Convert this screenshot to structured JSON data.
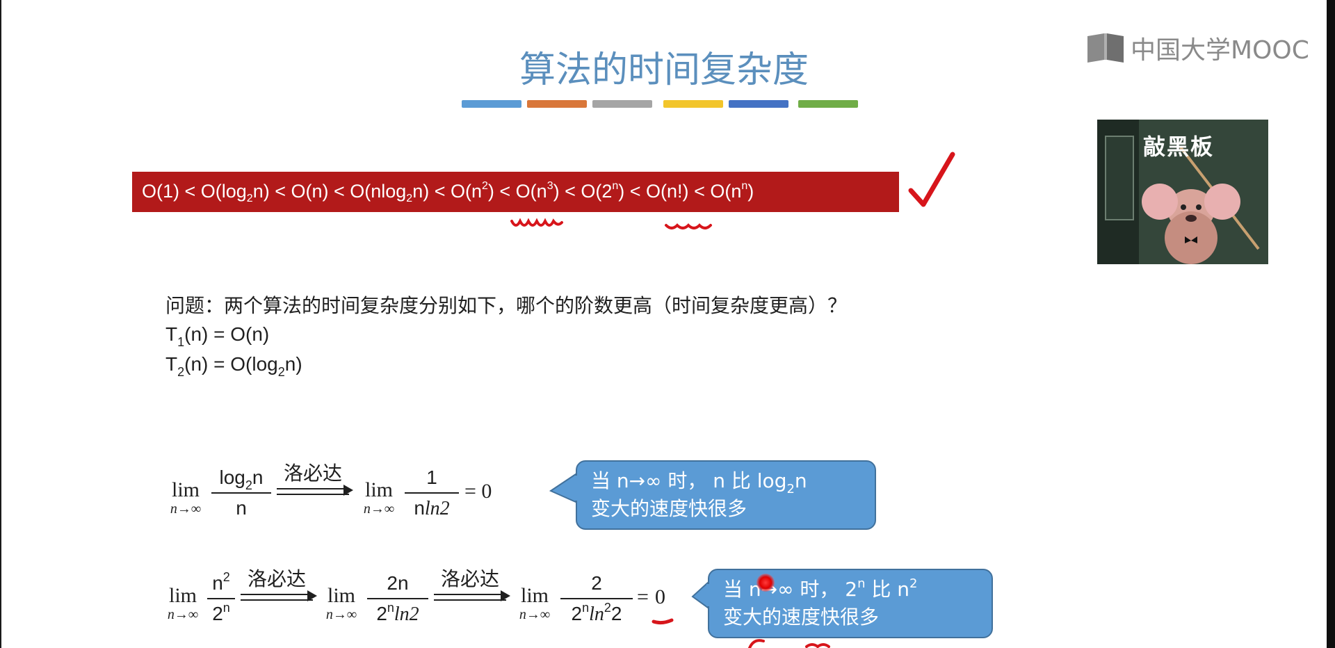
{
  "slide": {
    "title": "算法的时间复杂度",
    "logo_text": "中国大学MOOC",
    "promo_text": "敲黑板",
    "accent_colors": [
      "#5b9bd5",
      "#d9773a",
      "#a5a5a5",
      "#f2c52b",
      "#4472c4",
      "#70ad47"
    ],
    "banner": {
      "background": "#b21a1a",
      "terms": [
        "O(1)",
        "O(log2n)",
        "O(n)",
        "O(nlog2n)",
        "O(n2)",
        "O(n3)",
        "O(2n)",
        "O(n!)",
        "O(nn)"
      ]
    },
    "question": "问题：两个算法的时间复杂度分别如下，哪个的阶数更高（时间复杂度更高）？",
    "t1": {
      "lhs": "T",
      "sub": "1",
      "rest": "(n) = O(n)"
    },
    "t2": {
      "lhs": "T",
      "sub": "2",
      "rest_a": "(n) = O(log",
      "rest_sub": "2",
      "rest_b": "n)"
    },
    "formula1": {
      "lim": "lim",
      "lim_under": "n→∞",
      "num_a": "log",
      "num_sub": "2",
      "num_b": "n",
      "den": "n",
      "arrow_label": "洛必达",
      "num2": "1",
      "den2_a": "n",
      "den2_b": "ln2",
      "result": "= 0"
    },
    "callout1": {
      "line1_a": "当 n→∞ 时， n 比 log",
      "line1_sub": "2",
      "line1_b": "n",
      "line2": "变大的速度快很多"
    },
    "formula2": {
      "lim": "lim",
      "lim_under": "n→∞",
      "num_a": "n",
      "num_sup": "2",
      "den_a": "2",
      "den_sup": "n",
      "arrow_label": "洛必达",
      "num2": "2n",
      "den2_a": "2",
      "den2_sup": "n",
      "den2_b": "ln2",
      "num3": "2",
      "den3_a": "2",
      "den3_sup": "n",
      "den3_b": "ln",
      "den3_sup2": "2",
      "den3_c": "2",
      "result_eq": "=",
      "result": "0"
    },
    "callout2": {
      "line1_a": "当 n→∞ 时，  2",
      "line1_sup": "n",
      "line1_b": " 比 n",
      "line1_sup2": "2",
      "line2": "变大的速度快很多"
    }
  }
}
